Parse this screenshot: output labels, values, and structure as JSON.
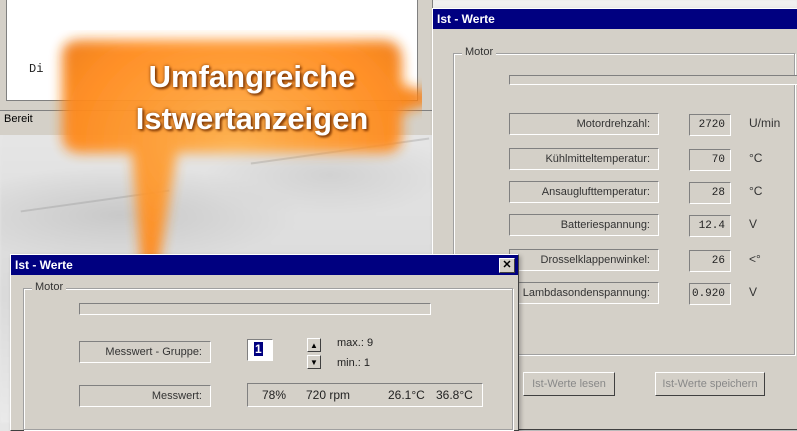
{
  "top_window": {
    "doc_text": "Di",
    "status_text": "Bereit"
  },
  "back_window": {
    "title": "Ist - Werte",
    "group_label": "Motor",
    "rows": [
      {
        "label": "Motordrehzahl:",
        "value": "2720",
        "unit": "U/min"
      },
      {
        "label": "Kühlmitteltemperatur:",
        "value": "70",
        "unit": "°C"
      },
      {
        "label": "Ansauglufttemperatur:",
        "value": "28",
        "unit": "°C"
      },
      {
        "label": "Batteriespannung:",
        "value": "12.4",
        "unit": "V"
      },
      {
        "label": "Drosselklappenwinkel:",
        "value": "26",
        "unit": "<°"
      },
      {
        "label": "Lambdasondenspannung:",
        "value": "0.920",
        "unit": "V"
      }
    ],
    "read_button": "Ist-Werte lesen",
    "save_button": "Ist-Werte speichern"
  },
  "front_window": {
    "title": "Ist - Werte",
    "close_glyph": "✕",
    "group_label": "Motor",
    "group_field_label": "Messwert - Gruppe:",
    "group_value": "1",
    "max_label": "max.: 9",
    "min_label": "min.: 1",
    "measure_label": "Messwert:",
    "measure_values": [
      "78%",
      "720 rpm",
      "26.1°C",
      "36.8°C"
    ]
  },
  "bubble": {
    "line1": "Umfangreiche",
    "line2": "Istwertanzeigen",
    "color": "#ff9a2a"
  }
}
